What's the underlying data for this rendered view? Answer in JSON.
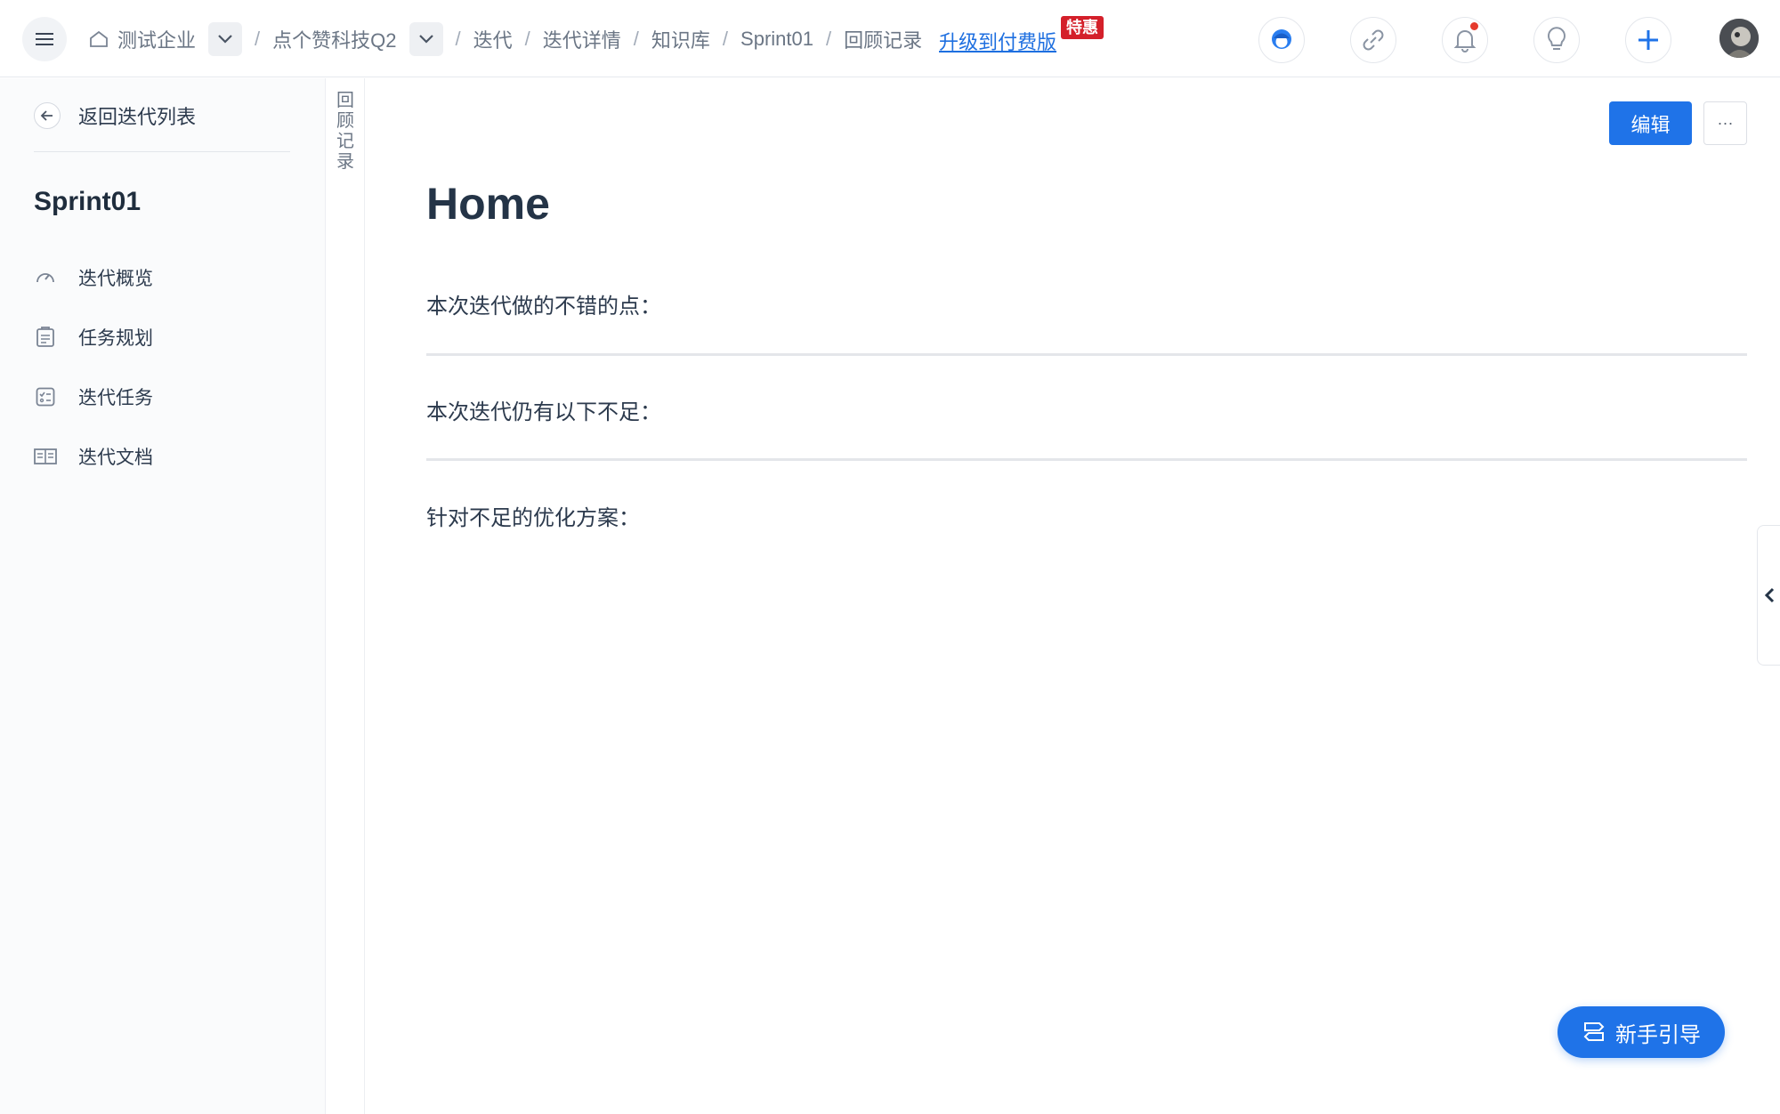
{
  "topbar": {
    "breadcrumbs": [
      "测试企业",
      "点个赞科技Q2",
      "迭代",
      "迭代详情",
      "知识库",
      "Sprint01",
      "回顾记录"
    ],
    "upgrade_label": "升级到付费版",
    "promo_badge": "特惠",
    "icons": [
      "menu-icon",
      "home-icon",
      "chevron-down-icon",
      "support-avatar-icon",
      "link-icon",
      "bell-icon",
      "lightbulb-icon",
      "plus-icon"
    ],
    "has_notification": true
  },
  "sidebar": {
    "back_label": "返回迭代列表",
    "sprint_name": "Sprint01",
    "items": [
      {
        "label": "迭代概览",
        "icon": "gauge-icon"
      },
      {
        "label": "任务规划",
        "icon": "clipboard-icon"
      },
      {
        "label": "迭代任务",
        "icon": "task-list-icon"
      },
      {
        "label": "迭代文档",
        "icon": "book-icon"
      }
    ]
  },
  "vertical_tab": {
    "label": "回顾记录"
  },
  "main": {
    "edit_label": "编辑",
    "more_label": "···",
    "title": "Home",
    "paragraphs": [
      "本次迭代做的不错的点：",
      "本次迭代仍有以下不足：",
      "针对不足的优化方案："
    ],
    "guide_label": "新手引导"
  },
  "colors": {
    "accent": "#1f73e8",
    "promo": "#d4202a",
    "notification": "#e5392c"
  }
}
